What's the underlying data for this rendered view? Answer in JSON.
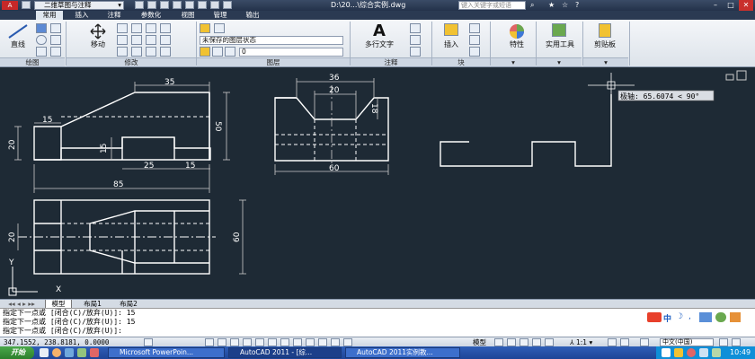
{
  "titlebar": {
    "app_icon": "A",
    "workspace": "二维草图与注释",
    "file_path": "D:\\20...\\综合实例.dwg",
    "help_search_placeholder": "键入关键字或短语",
    "minimize": "–",
    "restore": "□",
    "close": "✕"
  },
  "menu": {
    "tabs": [
      "常用",
      "插入",
      "注释",
      "参数化",
      "视图",
      "管理",
      "输出"
    ],
    "active_tab": "常用"
  },
  "ribbon": {
    "draw_line_label": "直线",
    "move_label": "移动",
    "layer_state": "未保存的图层状态",
    "layer_current": "0",
    "mtext_label": "多行文字",
    "insert_label": "插入",
    "properties_label": "特性",
    "utilities_label": "实用工具",
    "clipboard_label": "剪贴板",
    "groups": {
      "draw": "绘图",
      "modify": "修改",
      "layers": "图层",
      "annotation": "注释",
      "block": "块"
    }
  },
  "canvas": {
    "background": "#1e2a35",
    "tooltip": "极轴: 65.6074 < 90°",
    "dims": {
      "top_35": "35",
      "top_15": "15",
      "top_50": "50",
      "top_20": "20",
      "top_15b": "15",
      "top_25": "25",
      "top_15c": "15",
      "top_85": "85",
      "side_36": "36",
      "side_20": "20",
      "side_18": "18",
      "side_60": "60",
      "bot_20": "20",
      "bot_60": "60"
    },
    "ucs_x": "X",
    "ucs_y": "Y"
  },
  "layout_tabs": [
    "模型",
    "布局1",
    "布局2"
  ],
  "command": {
    "line1": "指定下一点或 [闭合(C)/放弃(U)]: 15",
    "line2": "指定下一点或 [闭合(C)/放弃(U)]: 15",
    "line3": "指定下一点或 [闭合(C)/放弃(U)]:"
  },
  "status": {
    "coords": "347.1552, 238.8181, 0.0000",
    "model_label": "模型",
    "scale": "1:1",
    "ime": "中文(中国)",
    "clock": "10:49"
  },
  "taskbar": {
    "start": "开始",
    "items": [
      "Microsoft PowerPoin...",
      "AutoCAD 2011 - [综...",
      "AutoCAD 2011实例教..."
    ]
  }
}
